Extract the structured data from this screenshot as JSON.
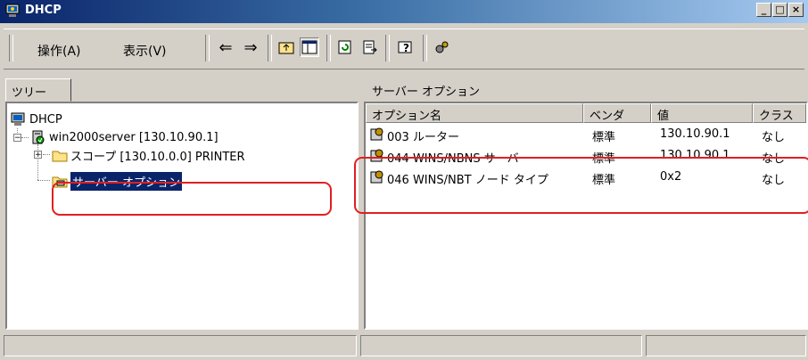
{
  "window": {
    "title": "DHCP"
  },
  "menu": {
    "action": "操作(A)",
    "view": "表示(V)"
  },
  "left_pane": {
    "tab_label": "ツリー"
  },
  "tree": {
    "root": "DHCP",
    "server": "win2000server [130.10.90.1]",
    "scope": "スコープ [130.10.0.0] PRINTER",
    "server_options": "サーバー オプション"
  },
  "right_pane": {
    "title": "サーバー オプション",
    "columns": [
      "オプション名",
      "ベンダ",
      "値",
      "クラス"
    ],
    "rows": [
      {
        "name": "003 ルーター",
        "vendor": "標準",
        "value": "130.10.90.1",
        "class": "なし"
      },
      {
        "name": "044 WINS/NBNS サーバー",
        "vendor": "標準",
        "value": "130.10.90.1",
        "class": "なし"
      },
      {
        "name": "046 WINS/NBT ノード タイプ",
        "vendor": "標準",
        "value": "0x2",
        "class": "なし"
      }
    ]
  },
  "icons": [
    "dhcp-icon",
    "back-arrow-icon",
    "forward-arrow-icon",
    "up-folder-icon",
    "show-hide-tree-icon",
    "refresh-icon",
    "export-list-icon",
    "help-icon",
    "settings-icon",
    "server-icon",
    "folder-icon",
    "option-icon"
  ],
  "colors": {
    "selection": "#0a246a",
    "highlight_box": "#e02020",
    "title_gradient_start": "#0a246a"
  }
}
